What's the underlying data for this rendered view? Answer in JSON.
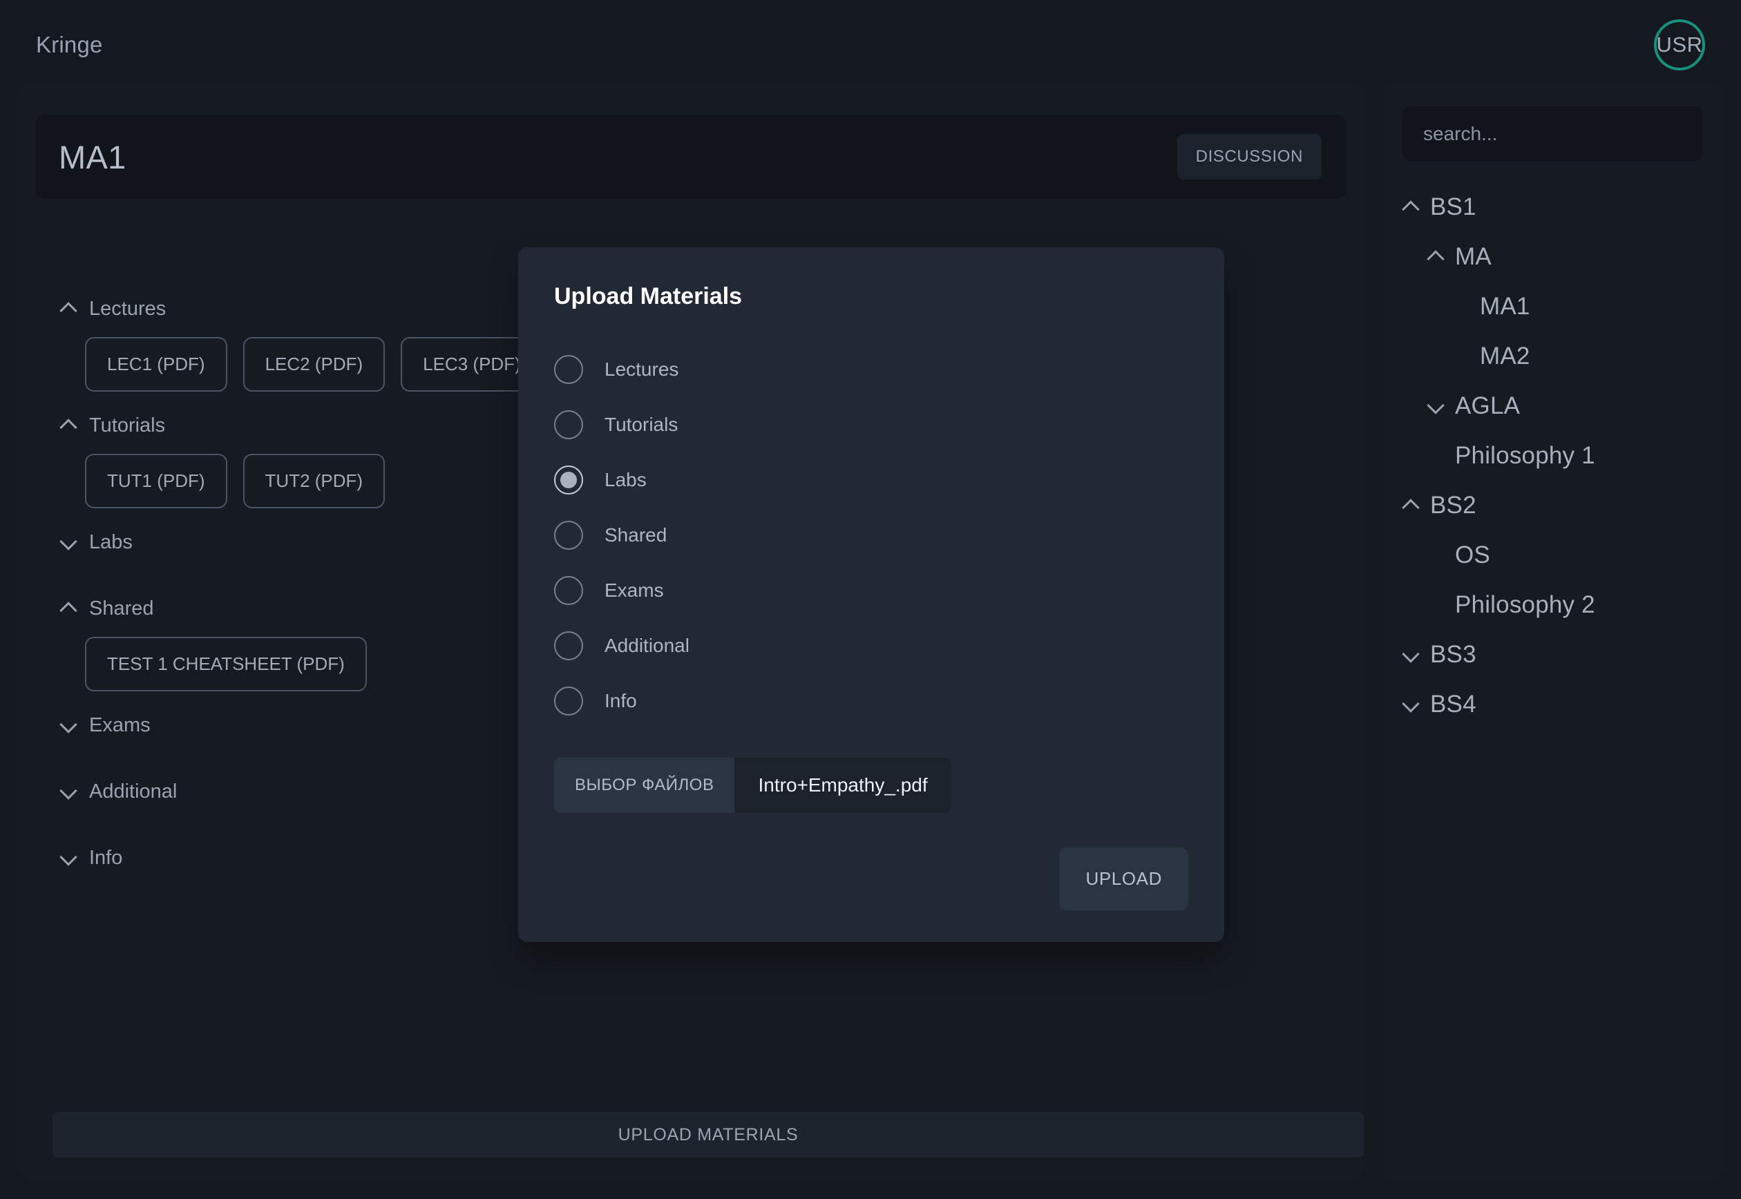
{
  "app": {
    "brand": "Kringe",
    "avatar_initials": "USR",
    "accent_color": "#17907d",
    "background": "#14181f",
    "panel_color": "#161b22",
    "modal_color": "#212934"
  },
  "course": {
    "title": "MA1",
    "discussion_label": "DISCUSSION"
  },
  "sections": [
    {
      "label": "Lectures",
      "expanded": true,
      "chevron": "chevron-up",
      "items": [
        "LEC1 (PDF)",
        "LEC2 (PDF)",
        "LEC3 (PDF)"
      ]
    },
    {
      "label": "Tutorials",
      "expanded": true,
      "chevron": "chevron-up",
      "items": [
        "TUT1 (PDF)",
        "TUT2 (PDF)"
      ]
    },
    {
      "label": "Labs",
      "expanded": false,
      "chevron": "chevron-down",
      "items": []
    },
    {
      "label": "Shared",
      "expanded": true,
      "chevron": "chevron-up",
      "items": [
        "TEST 1 CHEATSHEET (PDF)"
      ]
    },
    {
      "label": "Exams",
      "expanded": false,
      "chevron": "chevron-down",
      "items": []
    },
    {
      "label": "Additional",
      "expanded": false,
      "chevron": "chevron-down",
      "items": []
    },
    {
      "label": "Info",
      "expanded": false,
      "chevron": "chevron-down",
      "items": []
    }
  ],
  "modal": {
    "title": "Upload Materials",
    "options": [
      {
        "label": "Lectures",
        "selected": false
      },
      {
        "label": "Tutorials",
        "selected": false
      },
      {
        "label": "Labs",
        "selected": true
      },
      {
        "label": "Shared",
        "selected": false
      },
      {
        "label": "Exams",
        "selected": false
      },
      {
        "label": "Additional",
        "selected": false
      },
      {
        "label": "Info",
        "selected": false
      }
    ],
    "file_button_label": "ВЫБОР ФАЙЛОВ",
    "file_name": "Intro+Empathy_.pdf",
    "upload_label": "UPLOAD"
  },
  "bottom_bar": {
    "label": "UPLOAD MATERIALS"
  },
  "sidebar": {
    "search_placeholder": "search...",
    "search_value": "",
    "tree": [
      {
        "label": "BS1",
        "depth": 0,
        "chevron": "chevron-up"
      },
      {
        "label": "MA",
        "depth": 1,
        "chevron": "chevron-up"
      },
      {
        "label": "MA1",
        "depth": 2,
        "chevron": "none"
      },
      {
        "label": "MA2",
        "depth": 2,
        "chevron": "none"
      },
      {
        "label": "AGLA",
        "depth": 1,
        "chevron": "chevron-down"
      },
      {
        "label": "Philosophy 1",
        "depth": 1,
        "chevron": "none"
      },
      {
        "label": "BS2",
        "depth": 0,
        "chevron": "chevron-up"
      },
      {
        "label": "OS",
        "depth": 1,
        "chevron": "none"
      },
      {
        "label": "Philosophy 2",
        "depth": 1,
        "chevron": "none"
      },
      {
        "label": "BS3",
        "depth": 0,
        "chevron": "chevron-down"
      },
      {
        "label": "BS4",
        "depth": 0,
        "chevron": "chevron-down"
      }
    ]
  }
}
